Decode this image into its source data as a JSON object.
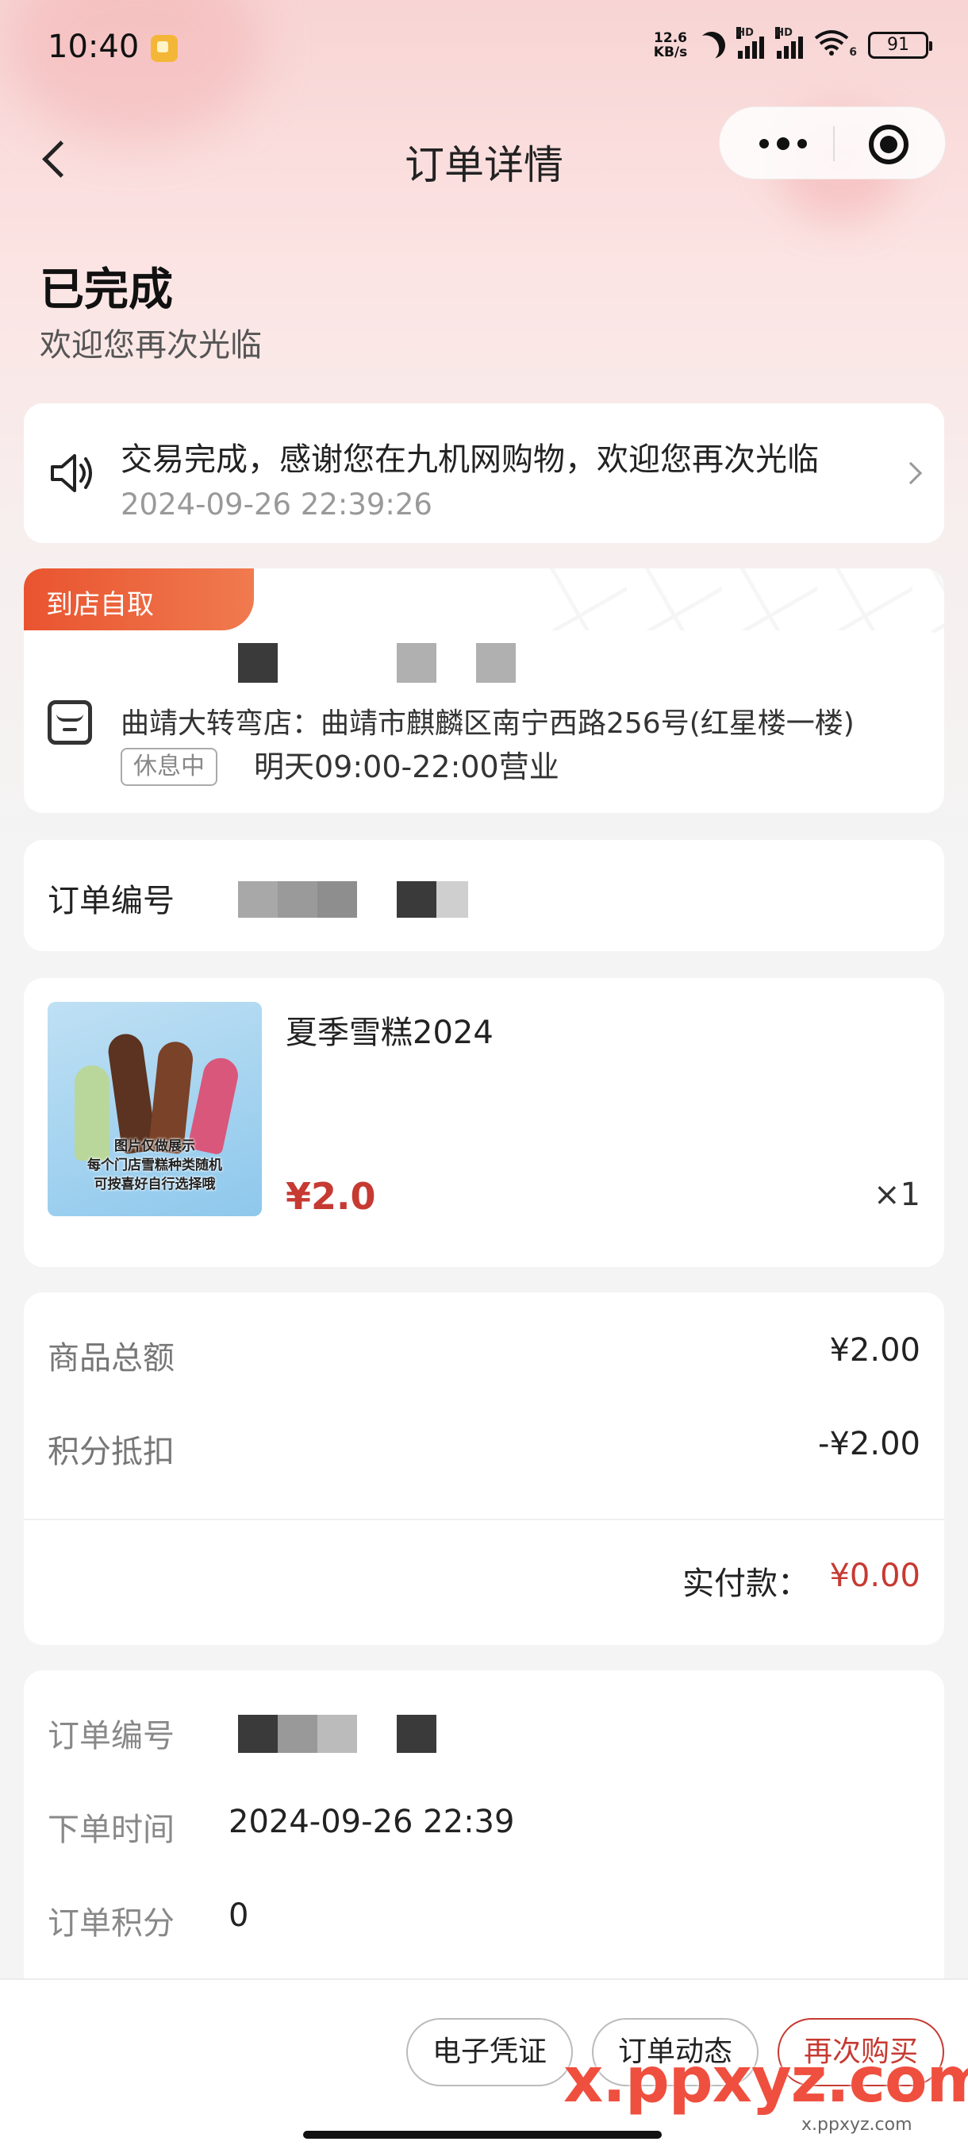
{
  "status_bar": {
    "time": "10:40",
    "net_speed_top": "12.6",
    "net_speed_bottom": "KB/s",
    "signal1_label": "HD",
    "signal2_label": "HD",
    "wifi_label": "6",
    "battery": "91"
  },
  "nav": {
    "title": "订单详情"
  },
  "order_status": {
    "title": "已完成",
    "subtitle": "欢迎您再次光临"
  },
  "notice": {
    "text": "交易完成，感谢您在九机网购物，欢迎您再次光临",
    "time": "2024-09-26 22:39:26"
  },
  "pickup": {
    "tag": "到店自取",
    "address": "曲靖大转弯店：曲靖市麒麟区南宁西路256号(红星楼一楼)",
    "status_badge": "休息中",
    "hours": "明天09:00-22:00营业"
  },
  "order_number_card": {
    "label": "订单编号"
  },
  "product": {
    "name": "夏季雪糕2024",
    "price": "¥2.0",
    "quantity": "×1",
    "image_caption_1": "图片仅做展示",
    "image_caption_2": "每个门店雪糕种类随机",
    "image_caption_3": "可按喜好自行选择哦"
  },
  "amounts": {
    "goods_total_label": "商品总额",
    "goods_total_value": "¥2.00",
    "points_label": "积分抵扣",
    "points_value": "-¥2.00",
    "paid_label": "实付款：",
    "paid_value": "¥0.00"
  },
  "details": {
    "order_no_label": "订单编号",
    "order_time_label": "下单时间",
    "order_time_value": "2024-09-26 22:39",
    "order_points_label": "订单积分",
    "order_points_value": "0"
  },
  "bottom_actions": {
    "voucher": "电子凭证",
    "tracking": "订单动态",
    "buy_again": "再次购买"
  },
  "watermark": {
    "text": "x.ppxyz.com",
    "sub": "x.ppxyz.com"
  },
  "colors": {
    "accent_red": "#c63a32",
    "pickup_tag": "#e9542f"
  }
}
